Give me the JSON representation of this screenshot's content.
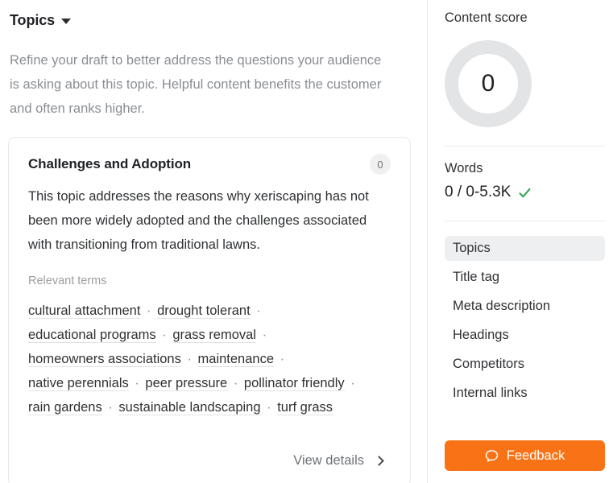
{
  "left": {
    "header": {
      "title": "Topics",
      "caret_icon": "chevron-down-icon"
    },
    "intro": "Refine your draft to better address the questions your audience is asking about this topic. Helpful content benefits the customer and often ranks higher.",
    "card": {
      "title": "Challenges and Adoption",
      "badge": "0",
      "description": "This topic addresses the reasons why xeriscaping has not been more widely adopted and the challenges associated with transitioning from traditional lawns.",
      "relevant_terms_label": "Relevant terms",
      "terms": [
        "cultural attachment",
        "drought tolerant",
        "educational programs",
        "grass removal",
        "homeowners associations",
        "maintenance",
        "native perennials",
        "peer pressure",
        "pollinator friendly",
        "rain gardens",
        "sustainable landscaping",
        "turf grass"
      ],
      "term_separator": "·",
      "view_details_label": "View details",
      "view_details_icon": "chevron-right-icon"
    }
  },
  "right": {
    "content_score_label": "Content score",
    "content_score_value": "0",
    "words_label": "Words",
    "words_value": "0 / 0-5.3K",
    "words_status_icon": "check-icon",
    "nav_items": [
      {
        "label": "Topics",
        "active": true
      },
      {
        "label": "Title tag",
        "active": false
      },
      {
        "label": "Meta description",
        "active": false
      },
      {
        "label": "Headings",
        "active": false
      },
      {
        "label": "Competitors",
        "active": false
      },
      {
        "label": "Internal links",
        "active": false
      }
    ],
    "feedback_label": "Feedback",
    "feedback_icon": "speech-bubble-icon"
  },
  "colors": {
    "accent_orange": "#f97316",
    "success_green": "#2da44e",
    "ring_gray": "#e3e4e6",
    "text_primary": "#1f2124",
    "text_muted": "#8b8e93"
  }
}
